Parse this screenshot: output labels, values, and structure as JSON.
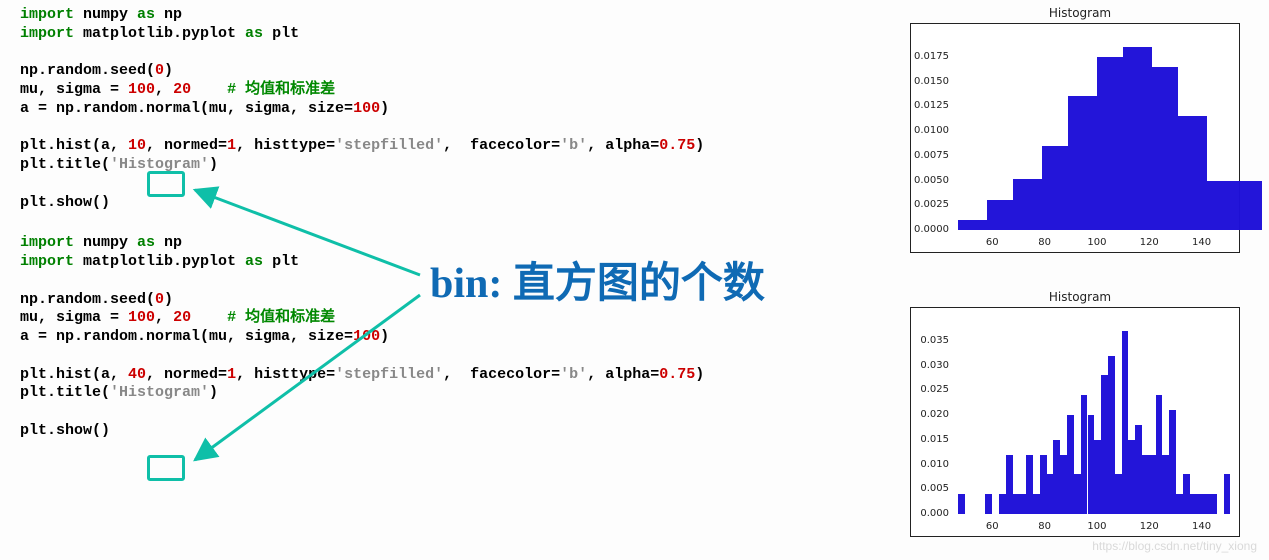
{
  "code": {
    "block1": {
      "l1a": "import",
      "l1b": " numpy ",
      "l1c": "as",
      "l1d": " np",
      "l2a": "import",
      "l2b": " matplotlib.pyplot ",
      "l2c": "as",
      "l2d": " plt",
      "l3": "np.random.seed(",
      "l3n": "0",
      "l3e": ")",
      "l4a": "mu, sigma = ",
      "l4n1": "100",
      "l4s": ", ",
      "l4n2": "20",
      "l4sp": "    ",
      "l4c": "# 均值和标准差",
      "l5a": "a = np.random.normal(mu, sigma, size=",
      "l5n": "100",
      "l5e": ")",
      "l6a": "plt.hist(a, ",
      "l6n": "10",
      "l6b": ", normed=",
      "l6n2": "1",
      "l6c": ", histtype=",
      "l6s1": "'stepfilled'",
      "l6d": ",  facecolor=",
      "l6s2": "'b'",
      "l6e": ", alpha=",
      "l6n3": "0.75",
      "l6f": ")",
      "l7a": "plt.title(",
      "l7s": "'Histogram'",
      "l7b": ")",
      "l8": "plt.show()"
    },
    "block2": {
      "l1a": "import",
      "l1b": " numpy ",
      "l1c": "as",
      "l1d": " np",
      "l2a": "import",
      "l2b": " matplotlib.pyplot ",
      "l2c": "as",
      "l2d": " plt",
      "l3": "np.random.seed(",
      "l3n": "0",
      "l3e": ")",
      "l4a": "mu, sigma = ",
      "l4n1": "100",
      "l4s": ", ",
      "l4n2": "20",
      "l4sp": "    ",
      "l4c": "# 均值和标准差",
      "l5a": "a = np.random.normal(mu, sigma, size=",
      "l5n": "100",
      "l5e": ")",
      "l6a": "plt.hist(a, ",
      "l6n": "40",
      "l6b": ", normed=",
      "l6n2": "1",
      "l6c": ", histtype=",
      "l6s1": "'stepfilled'",
      "l6d": ",  facecolor=",
      "l6s2": "'b'",
      "l6e": ", alpha=",
      "l6n3": "0.75",
      "l6f": ")",
      "l7a": "plt.title(",
      "l7s": "'Histogram'",
      "l7b": ")",
      "l8": "plt.show()"
    }
  },
  "annotation": "bin: 直方图的个数",
  "watermark": "https://blog.csdn.net/tiny_xiong",
  "chart_data": [
    {
      "type": "bar",
      "title": "Histogram",
      "xlabel": "",
      "ylabel": "",
      "xlim": [
        45,
        152
      ],
      "ylim": [
        0,
        0.02
      ],
      "yticks": [
        0.0,
        0.0025,
        0.005,
        0.0075,
        0.01,
        0.0125,
        0.015,
        0.0175
      ],
      "xticks": [
        60,
        80,
        100,
        120,
        140
      ],
      "bin_edges": [
        47,
        58,
        68,
        79,
        89,
        100,
        110,
        121,
        131,
        142,
        152
      ],
      "values": [
        0.001,
        0.003,
        0.0052,
        0.0085,
        0.0135,
        0.0175,
        0.0185,
        0.0165,
        0.0115,
        0.005,
        0.005
      ]
    },
    {
      "type": "bar",
      "title": "Histogram",
      "xlabel": "",
      "ylabel": "",
      "xlim": [
        45,
        152
      ],
      "ylim": [
        0,
        0.04
      ],
      "yticks": [
        0.0,
        0.005,
        0.01,
        0.015,
        0.02,
        0.025,
        0.03,
        0.035
      ],
      "xticks": [
        60,
        80,
        100,
        120,
        140
      ],
      "bin_edges": [
        47,
        49.6,
        52.2,
        54.8,
        57.4,
        60,
        62.6,
        65.2,
        67.8,
        70.4,
        73,
        75.6,
        78.2,
        80.8,
        83.4,
        86,
        88.6,
        91.2,
        93.8,
        96.4,
        99,
        101.6,
        104.2,
        106.8,
        109.4,
        112,
        114.6,
        117.2,
        119.8,
        122.4,
        125,
        127.6,
        130.2,
        132.8,
        135.4,
        138,
        140.6,
        143.2,
        145.8,
        148.4,
        151
      ],
      "values": [
        0.004,
        0,
        0,
        0,
        0.004,
        0,
        0.004,
        0.012,
        0.004,
        0.004,
        0.012,
        0.004,
        0.012,
        0.008,
        0.015,
        0.012,
        0.02,
        0.008,
        0.024,
        0.02,
        0.015,
        0.028,
        0.032,
        0.008,
        0.037,
        0.015,
        0.018,
        0.012,
        0.012,
        0.024,
        0.012,
        0.021,
        0.004,
        0.008,
        0.004,
        0.004,
        0.004,
        0.004,
        0,
        0.008
      ]
    }
  ]
}
